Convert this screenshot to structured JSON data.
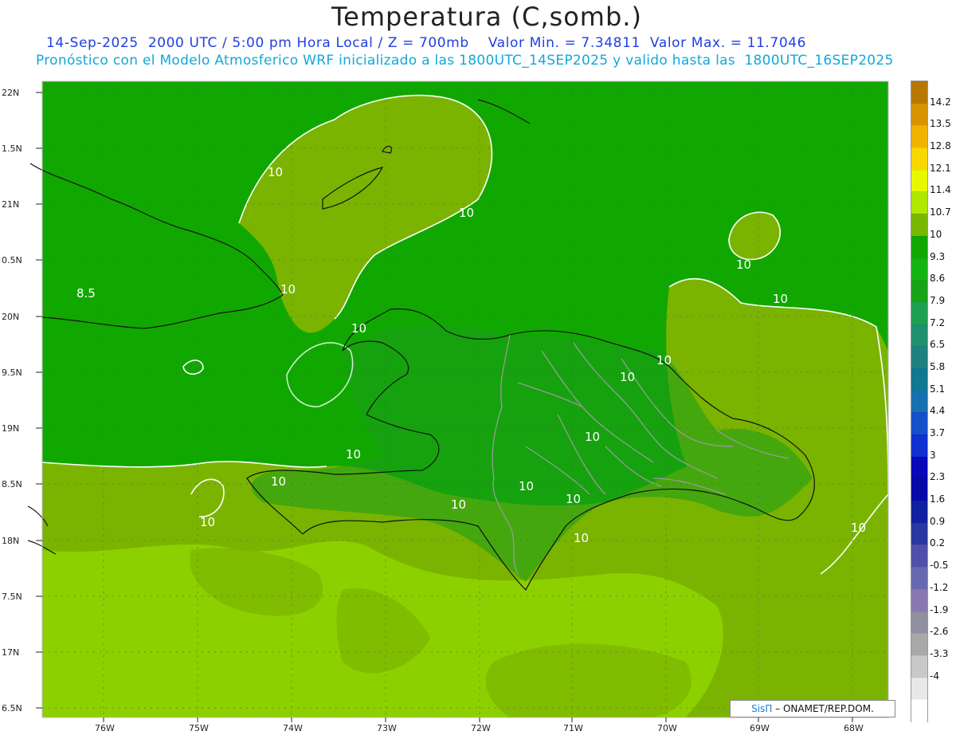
{
  "title": "Temperatura (C,somb.)",
  "subtitle_line1": "14-Sep-2025  2000 UTC / 5:00 pm Hora Local / Z = 700mb    Valor Min. = 7.34811  Valor Max. = 11.7046",
  "subtitle_line2": "Pronóstico con el Modelo Atmosferico WRF inicializado a las 1800UTC_14SEP2025 y valido hasta las  1800UTC_16SEP2025",
  "map": {
    "lon_ticks": [
      "76W",
      "75W",
      "74W",
      "73W",
      "72W",
      "71W",
      "70W",
      "69W",
      "68W"
    ],
    "lat_ticks": [
      "22N",
      "1.5N",
      "21N",
      "0.5N",
      "20N",
      "9.5N",
      "19N",
      "8.5N",
      "18N",
      "7.5N",
      "17N",
      "6.5N"
    ],
    "contour_labels": [
      "10",
      "10",
      "10",
      "10",
      "10",
      "10",
      "10",
      "10",
      "10",
      "10",
      "10",
      "10",
      "10",
      "10",
      "10",
      "10",
      "10",
      "8.5"
    ],
    "credit_brand": "SisΠ",
    "credit_text": "– ONAMET/REP.DOM."
  },
  "colorbar": {
    "labels": [
      "14.2",
      "13.5",
      "12.8",
      "12.1",
      "11.4",
      "10.7",
      "10",
      "9.3",
      "8.6",
      "7.9",
      "7.2",
      "6.5",
      "5.8",
      "5.1",
      "4.4",
      "3.7",
      "3",
      "2.3",
      "1.6",
      "0.9",
      "0.2",
      "-0.5",
      "-1.2",
      "-1.9",
      "-2.6",
      "-3.3",
      "-4"
    ],
    "colors": [
      "#b87800",
      "#d89400",
      "#f0b400",
      "#f8d800",
      "#e8f800",
      "#b0e800",
      "#7ab800",
      "#10a800",
      "#14b414",
      "#18a418",
      "#1ea050",
      "#209070",
      "#208080",
      "#107890",
      "#1870b0",
      "#1450c8",
      "#1030d0",
      "#0808b8",
      "#0808a8",
      "#1020a0",
      "#2838a0",
      "#5050a8",
      "#6868b0",
      "#8878b0",
      "#9090a0",
      "#a8a8a8",
      "#c8c8c8",
      "#e8e8e8",
      "#ffffff"
    ]
  }
}
